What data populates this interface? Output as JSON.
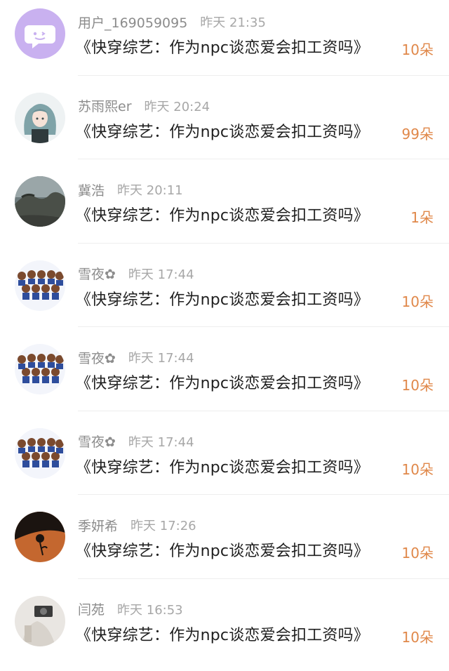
{
  "comments": [
    {
      "user": "用户_169059095",
      "time": "昨天 21:35",
      "title": "《快穿综艺：作为npc谈恋爱会扣工资吗》",
      "count": "10朵",
      "avatar": "purple-chat-avatar"
    },
    {
      "user": "苏雨熙er",
      "time": "昨天 20:24",
      "title": "《快穿综艺：作为npc谈恋爱会扣工资吗》",
      "count": "99朵",
      "avatar": "anime-girl-avatar"
    },
    {
      "user": "冀浩",
      "time": "昨天 20:11",
      "title": "《快穿综艺：作为npc谈恋爱会扣工资吗》",
      "count": "1朵",
      "avatar": "landscape-avatar"
    },
    {
      "user": "雪夜✿",
      "time": "昨天 17:44",
      "title": "《快穿综艺：作为npc谈恋爱会扣工资吗》",
      "count": "10朵",
      "avatar": "group-chibi-avatar"
    },
    {
      "user": "雪夜✿",
      "time": "昨天 17:44",
      "title": "《快穿综艺：作为npc谈恋爱会扣工资吗》",
      "count": "10朵",
      "avatar": "group-chibi-avatar"
    },
    {
      "user": "雪夜✿",
      "time": "昨天 17:44",
      "title": "《快穿综艺：作为npc谈恋爱会扣工资吗》",
      "count": "10朵",
      "avatar": "group-chibi-avatar"
    },
    {
      "user": "季妍希",
      "time": "昨天 17:26",
      "title": "《快穿综艺：作为npc谈恋爱会扣工资吗》",
      "count": "10朵",
      "avatar": "rose-silhouette-avatar"
    },
    {
      "user": "闫苑",
      "time": "昨天 16:53",
      "title": "《快穿综艺：作为npc谈恋爱会扣工资吗》",
      "count": "10朵",
      "avatar": "photo-avatar"
    }
  ],
  "colors": {
    "count": "#e0884a",
    "name": "#8c8c8c",
    "time": "#a7a7a7",
    "title": "#1f1f1f",
    "avatar_purple": "#c9b1f0"
  }
}
